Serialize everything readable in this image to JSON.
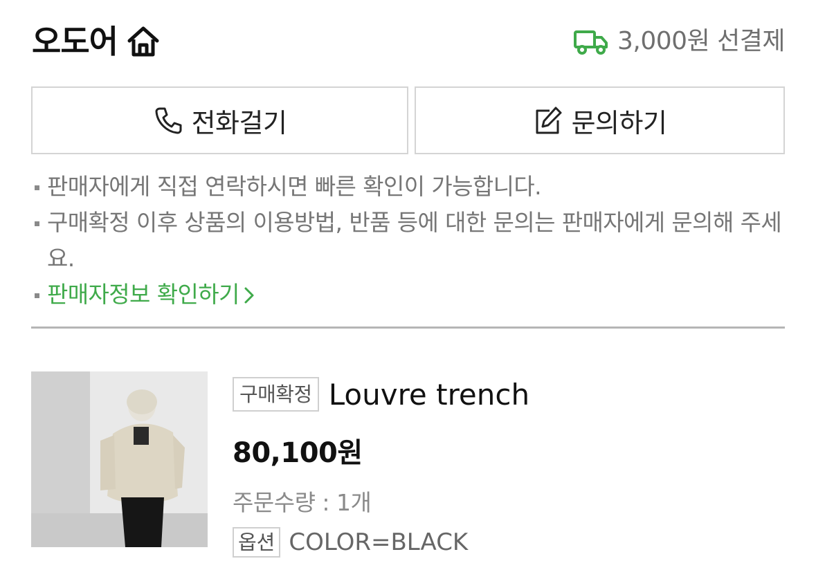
{
  "header": {
    "shop_name": "오도어",
    "shipping_text": "3,000원 선결제"
  },
  "buttons": {
    "call_label": "전화걸기",
    "inquiry_label": "문의하기"
  },
  "notices": [
    "판매자에게 직접 연락하시면 빠른 확인이 가능합니다.",
    "구매확정 이후 상품의 이용방법, 반품 등에 대한 문의는 판매자에게 문의해 주세요.",
    "판매자정보 확인하기"
  ],
  "product": {
    "status_badge": "구매확정",
    "title": "Louvre trench",
    "price": "80,100원",
    "quantity_label": "주문수량 : 1개",
    "option_badge": "옵션",
    "option_value": "COLOR=BLACK"
  },
  "colors": {
    "accent_green": "#3faa4a",
    "text_gray": "#767676",
    "border": "#d4d4d4"
  },
  "icons": [
    "home-icon",
    "truck-icon",
    "phone-icon",
    "edit-icon",
    "chevron-right-icon"
  ]
}
